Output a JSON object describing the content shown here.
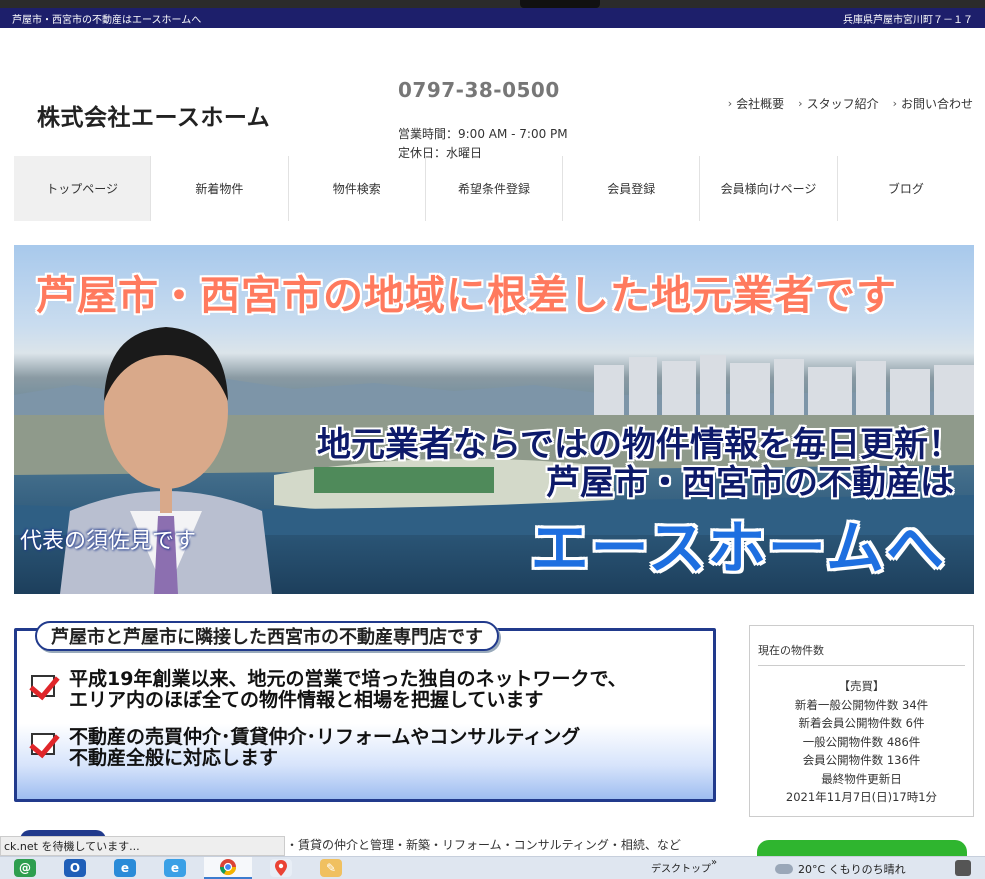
{
  "topbar": {
    "left": "芦屋市・西宮市の不動産はエースホームへ",
    "right": "兵庫県芦屋市宮川町７－１７"
  },
  "header": {
    "logo": "株式会社エースホーム",
    "phone": "0797-38-0500",
    "hours": "営業時間：9:00 AM - 7:00 PM",
    "closed": "定休日：水曜日",
    "links": [
      "会社概要",
      "スタッフ紹介",
      "お問い合わせ"
    ]
  },
  "nav": {
    "items": [
      "トップページ",
      "新着物件",
      "物件検索",
      "希望条件登録",
      "会員登録",
      "会員様向けページ",
      "ブログ"
    ],
    "active_index": 0
  },
  "hero": {
    "title": "芦屋市・西宮市の地域に根差した地元業者です",
    "line1": "地元業者ならではの物件情報を毎日更新！",
    "line2": "芦屋市・西宮市の不動産は",
    "line3": "エースホームへ",
    "caption": "代表の須佐見です"
  },
  "intro": {
    "heading": "芦屋市と芦屋市に隣接した西宮市の不動産専門店です",
    "points": [
      {
        "line1": "平成19年創業以来、地元の営業で培った独自のネットワークで、",
        "line2": "エリア内のほぼ全ての物件情報と相場を把握しています"
      },
      {
        "line1": "不動産の売買仲介･賃貸仲介･リフォームやコンサルティング",
        "line2": "不動産全般に対応します"
      }
    ]
  },
  "stock": {
    "title": "現在の物件数",
    "section": "【売買】",
    "lines": [
      "新着一般公開物件数 34件",
      "新着会員公開物件数 6件",
      "一般公開物件数 486件",
      "会員公開物件数 136件",
      "最終物件更新日",
      "2021年11月7日(日)17時1分"
    ]
  },
  "bottom": {
    "text": "・賃貸の仲介と管理・新築・リフォーム・コンサルティング・相続、など"
  },
  "status": {
    "text": "ck.net を待機しています..."
  },
  "taskbar": {
    "desktop": "デスクトップ",
    "chevron": "»",
    "weather": "20°C くもりのち晴れ",
    "icons": [
      "mail-icon",
      "outlook-icon",
      "edge-icon",
      "ie-icon",
      "chrome-icon",
      "maps-icon",
      "paint-icon"
    ]
  },
  "colors": {
    "topbar": "#1d1f6b",
    "navy": "#213a8c",
    "accent_red": "#e0262a",
    "hero_title": "#ff7a5e",
    "hero_blue": "#1e6fe0"
  }
}
